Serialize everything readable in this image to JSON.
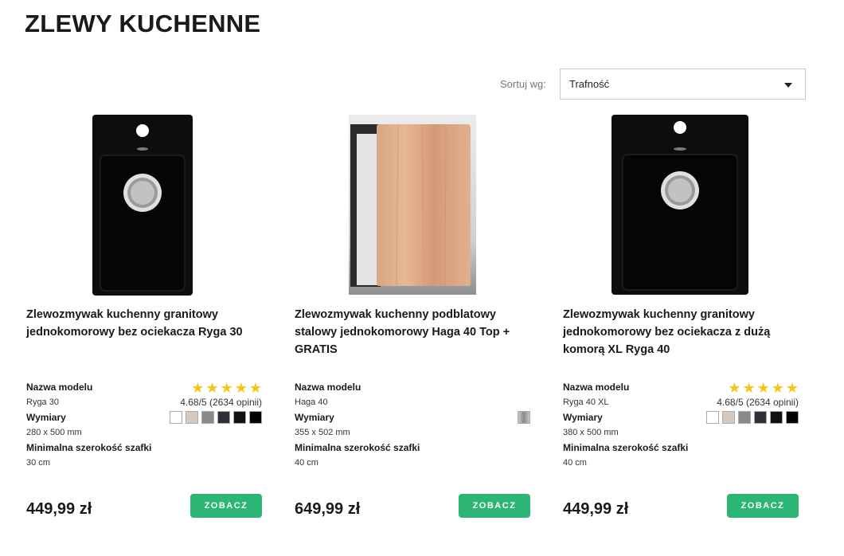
{
  "page": {
    "title": "ZLEWY KUCHENNE"
  },
  "sort": {
    "label": "Sortuj wg:",
    "selected": "Trafność"
  },
  "products": [
    {
      "name": "Zlewozmywak kuchenny granitowy jednokomorowy bez ociekacza Ryga 30",
      "model_label": "Nazwa modelu",
      "model": "Ryga 30",
      "dim_label": "Wymiary",
      "dim": "280 x 500 mm",
      "cab_label": "Minimalna szerokość szafki",
      "cab": "30 cm",
      "rating": "4.68/5 (2634 opinii)",
      "stars": 5,
      "swatches": [
        "#ffffff",
        "#d8c8bd",
        "#8a8a8a",
        "#2d3038",
        "#111111",
        "#000000"
      ],
      "price": "449,99 zł",
      "button": "ZOBACZ"
    },
    {
      "name": "Zlewozmywak kuchenny podblatowy stalowy jednokomorowy Haga 40 Top + GRATIS",
      "model_label": "Nazwa modelu",
      "model": "Haga 40",
      "dim_label": "Wymiary",
      "dim": "355 x 502 mm",
      "cab_label": "Minimalna szerokość szafki",
      "cab": "40 cm",
      "rating": "",
      "stars": 0,
      "swatches": [
        "#9a9a9a"
      ],
      "price": "649,99 zł",
      "button": "ZOBACZ"
    },
    {
      "name": "Zlewozmywak kuchenny granitowy jednokomorowy bez ociekacza z dużą komorą XL Ryga 40",
      "model_label": "Nazwa modelu",
      "model": "Ryga 40 XL",
      "dim_label": "Wymiary",
      "dim": "380 x 500 mm",
      "cab_label": "Minimalna szerokość szafki",
      "cab": "40 cm",
      "rating": "4.68/5 (2634 opinii)",
      "stars": 5,
      "swatches": [
        "#ffffff",
        "#d8c8bd",
        "#8a8a8a",
        "#2d3038",
        "#111111",
        "#000000"
      ],
      "price": "449,99 zł",
      "button": "ZOBACZ"
    }
  ],
  "colors": {
    "accent": "#2bb673",
    "star": "#f5c518"
  },
  "icons": {
    "sort": "caret-down-icon",
    "rating": "star-icon"
  }
}
